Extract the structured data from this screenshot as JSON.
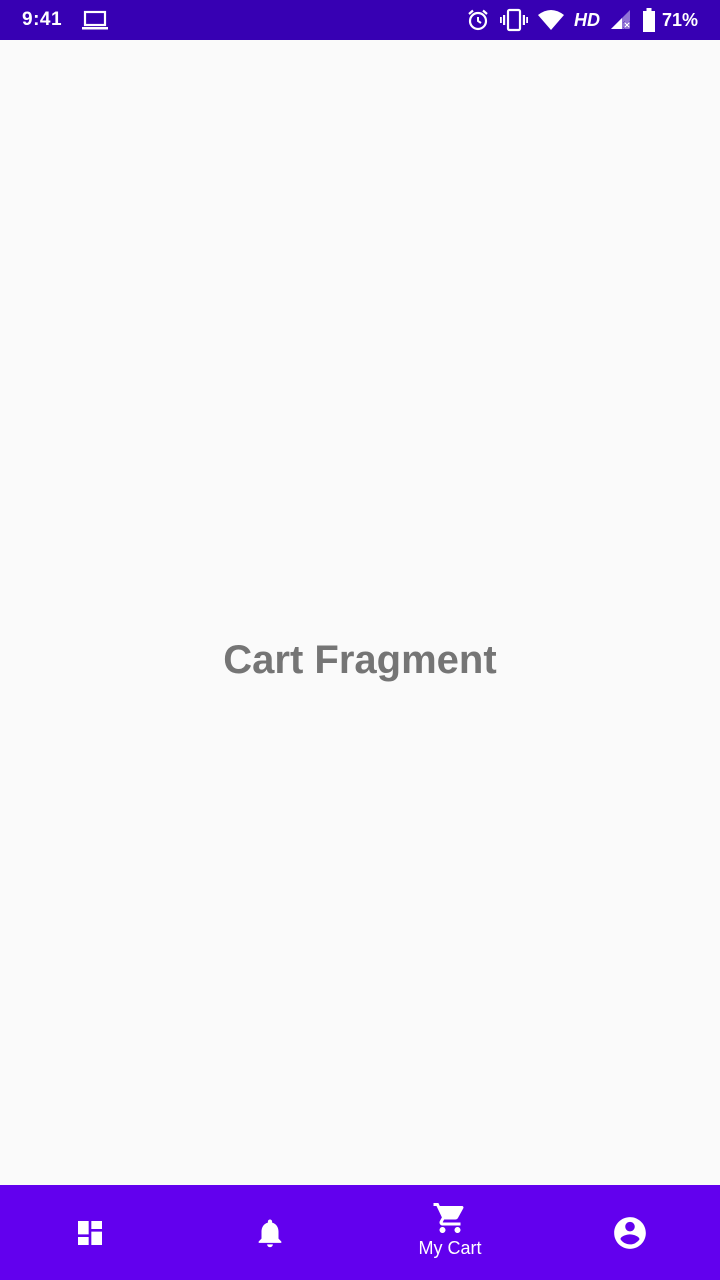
{
  "status_bar": {
    "time": "9:41",
    "network": "HD",
    "battery": "71%",
    "icons": [
      "laptop-icon",
      "alarm-icon",
      "vibrate-icon",
      "wifi-icon",
      "signal-icon",
      "battery-icon"
    ],
    "background": "#3700B3"
  },
  "main": {
    "title": "Cart Fragment",
    "text_color": "#757575",
    "background": "#FAFAFA"
  },
  "bottom_nav": {
    "background": "#6200EE",
    "items": [
      {
        "icon": "dashboard-icon",
        "label": "",
        "active": false
      },
      {
        "icon": "bell-icon",
        "label": "",
        "active": false
      },
      {
        "icon": "cart-icon",
        "label": "My Cart",
        "active": true
      },
      {
        "icon": "account-circle-icon",
        "label": "",
        "active": false
      }
    ]
  }
}
